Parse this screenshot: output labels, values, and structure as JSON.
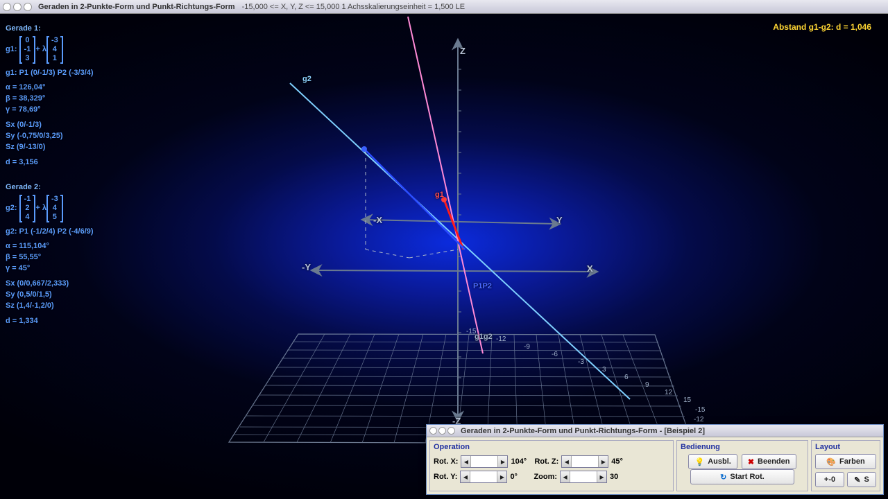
{
  "window": {
    "title": "Geraden in 2-Punkte-Form und Punkt-Richtungs-Form",
    "subtitle": "-15,000 <= X, Y, Z <= 15,000   1 Achsskalierungseinheit = 1,500 LE"
  },
  "distance": "Abstand g1-g2: d = 1,046",
  "gerade1": {
    "header": "Gerade 1:",
    "eq_prefix": "g1:",
    "point_vec": [
      "0",
      "-1",
      "3"
    ],
    "lambda": " + λ ",
    "dir_vec": [
      "-3",
      "4",
      "1"
    ],
    "points": "g1: P1 (0/-1/3)   P2 (-3/3/4)",
    "alpha": "α = 126,04°",
    "beta": "β = 38,329°",
    "gamma": "γ = 78,69°",
    "sx": "Sx (0/-1/3)",
    "sy": "Sy (-0,75/0/3,25)",
    "sz": "Sz (9/-13/0)",
    "d": "d = 3,156"
  },
  "gerade2": {
    "header": "Gerade 2:",
    "eq_prefix": "g2:",
    "point_vec": [
      "-1",
      "2",
      "4"
    ],
    "lambda": " + λ ",
    "dir_vec": [
      "-3",
      "4",
      "5"
    ],
    "points": "g2: P1 (-1/2/4)   P2 (-4/6/9)",
    "alpha": "α = 115,104°",
    "beta": "β = 55,55°",
    "gamma": "γ = 45°",
    "sx": "Sx (0/0,667/2,333)",
    "sy": "Sy (0,5/0/1,5)",
    "sz": "Sz (1,4/-1,2/0)",
    "d": "d = 1,334"
  },
  "scene": {
    "axis_x": "X",
    "axis_nx": "-X",
    "axis_y": "Y",
    "axis_ny": "-Y",
    "axis_z": "Z",
    "axis_nz": "-Z",
    "g1_label": "g1",
    "g2_label": "g2",
    "p1p2_label": "P1P2",
    "ticks": [
      "-15",
      "-12",
      "-9",
      "-6",
      "-3",
      "3",
      "6",
      "9",
      "12",
      "15"
    ],
    "ticks_neg": [
      "-15",
      "-12",
      "-9",
      "-6",
      "-3"
    ]
  },
  "ctrl": {
    "title": "Geraden in 2-Punkte-Form und Punkt-Richtungs-Form - [Beispiel 2]",
    "op_legend": "Operation",
    "bed_legend": "Bedienung",
    "lay_legend": "Layout",
    "rotx_label": "Rot. X:",
    "roty_label": "Rot. Y:",
    "rotz_label": "Rot. Z:",
    "zoom_label": "Zoom:",
    "rotx_val": "104°",
    "roty_val": "0°",
    "rotz_val": "45°",
    "zoom_val": "30",
    "btn_ausbl": "Ausbl.",
    "btn_beenden": "Beenden",
    "btn_startrot": "Start Rot.",
    "btn_farben": "Farben",
    "btn_plus0": "+-0",
    "btn_s": "S"
  },
  "chart_data": {
    "type": "line",
    "title": "Geraden in 2-Punkte-Form und Punkt-Richtungs-Form",
    "space": "3D",
    "axis_range": {
      "x": [
        -15,
        15
      ],
      "y": [
        -15,
        15
      ],
      "z": [
        -15,
        15
      ]
    },
    "axis_unit_LE": 1.5,
    "series": [
      {
        "name": "g1",
        "point": [
          0,
          -1,
          3
        ],
        "direction": [
          -3,
          4,
          1
        ],
        "p2": [
          -3,
          3,
          4
        ],
        "angles_deg": {
          "alpha": 126.04,
          "beta": 38.329,
          "gamma": 78.69
        },
        "intercepts": {
          "Sx": [
            0,
            -1,
            3
          ],
          "Sy": [
            -0.75,
            0,
            3.25
          ],
          "Sz": [
            9,
            -13,
            0
          ]
        },
        "dist_origin": 3.156,
        "color": "#ff6ad8"
      },
      {
        "name": "g2",
        "point": [
          -1,
          2,
          4
        ],
        "direction": [
          -3,
          4,
          5
        ],
        "p2": [
          -4,
          6,
          9
        ],
        "angles_deg": {
          "alpha": 115.104,
          "beta": 55.55,
          "gamma": 45
        },
        "intercepts": {
          "Sx": [
            0,
            0.667,
            2.333
          ],
          "Sy": [
            0.5,
            0,
            1.5
          ],
          "Sz": [
            1.4,
            -1.2,
            0
          ]
        },
        "dist_origin": 1.334,
        "color": "#6fc8ff"
      }
    ],
    "distance_between": 1.046,
    "connector": {
      "name": "P1P2",
      "from": [
        0,
        -1,
        3
      ],
      "to": [
        -1,
        2,
        4
      ],
      "color": "#2040ff"
    },
    "view": {
      "rot_x": 104,
      "rot_y": 0,
      "rot_z": 45,
      "zoom": 30
    }
  }
}
